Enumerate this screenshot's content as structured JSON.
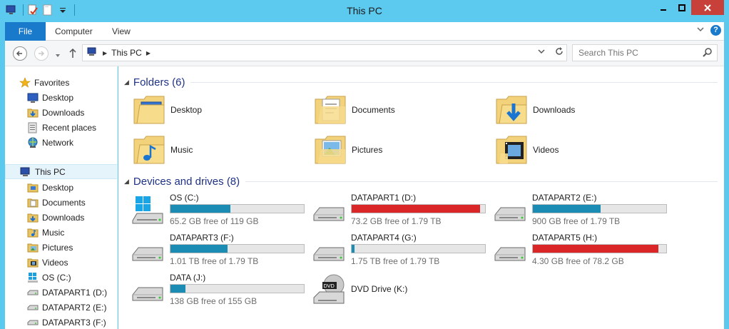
{
  "window": {
    "title": "This PC"
  },
  "ribbon": {
    "tabs": [
      "File",
      "Computer",
      "View"
    ]
  },
  "address": {
    "crumbs": [
      "This PC"
    ]
  },
  "search": {
    "placeholder": "Search This PC"
  },
  "sidebar": {
    "favorites_label": "Favorites",
    "favorites": [
      "Desktop",
      "Downloads",
      "Recent places",
      "Network"
    ],
    "thispc_label": "This PC",
    "thispc_items": [
      "Desktop",
      "Documents",
      "Downloads",
      "Music",
      "Pictures",
      "Videos",
      "OS (C:)",
      "DATAPART1 (D:)",
      "DATAPART2 (E:)",
      "DATAPART3 (F:)"
    ]
  },
  "folders": {
    "title": "Folders (6)",
    "items": [
      "Desktop",
      "Documents",
      "Downloads",
      "Music",
      "Pictures",
      "Videos"
    ]
  },
  "drives": {
    "title": "Devices and drives (8)",
    "items": [
      {
        "name": "OS (C:)",
        "free": "65.2 GB free of 119 GB",
        "used_pct": 45,
        "status": "normal",
        "icon": "windows-drive"
      },
      {
        "name": "DATAPART1 (D:)",
        "free": "73.2 GB free of 1.79 TB",
        "used_pct": 96,
        "status": "full",
        "icon": "hdd"
      },
      {
        "name": "DATAPART2 (E:)",
        "free": "900 GB free of 1.79 TB",
        "used_pct": 51,
        "status": "normal",
        "icon": "hdd"
      },
      {
        "name": "DATAPART3 (F:)",
        "free": "1.01 TB free of 1.79 TB",
        "used_pct": 43,
        "status": "normal",
        "icon": "hdd"
      },
      {
        "name": "DATAPART4 (G:)",
        "free": "1.75 TB free of 1.79 TB",
        "used_pct": 2,
        "status": "normal",
        "icon": "hdd"
      },
      {
        "name": "DATAPART5 (H:)",
        "free": "4.30 GB free of 78.2 GB",
        "used_pct": 94,
        "status": "full",
        "icon": "hdd"
      },
      {
        "name": "DATA (J:)",
        "free": "138 GB free of 155 GB",
        "used_pct": 11,
        "status": "normal",
        "icon": "hdd"
      },
      {
        "name": "DVD Drive (K:)",
        "free": "",
        "used_pct": null,
        "status": "none",
        "icon": "dvd"
      }
    ]
  },
  "colors": {
    "titlebar": "#5cc9ee",
    "file_tab": "#1979ca",
    "bar_normal": "#1b8db4",
    "bar_full": "#da2626",
    "close": "#c7403a"
  }
}
